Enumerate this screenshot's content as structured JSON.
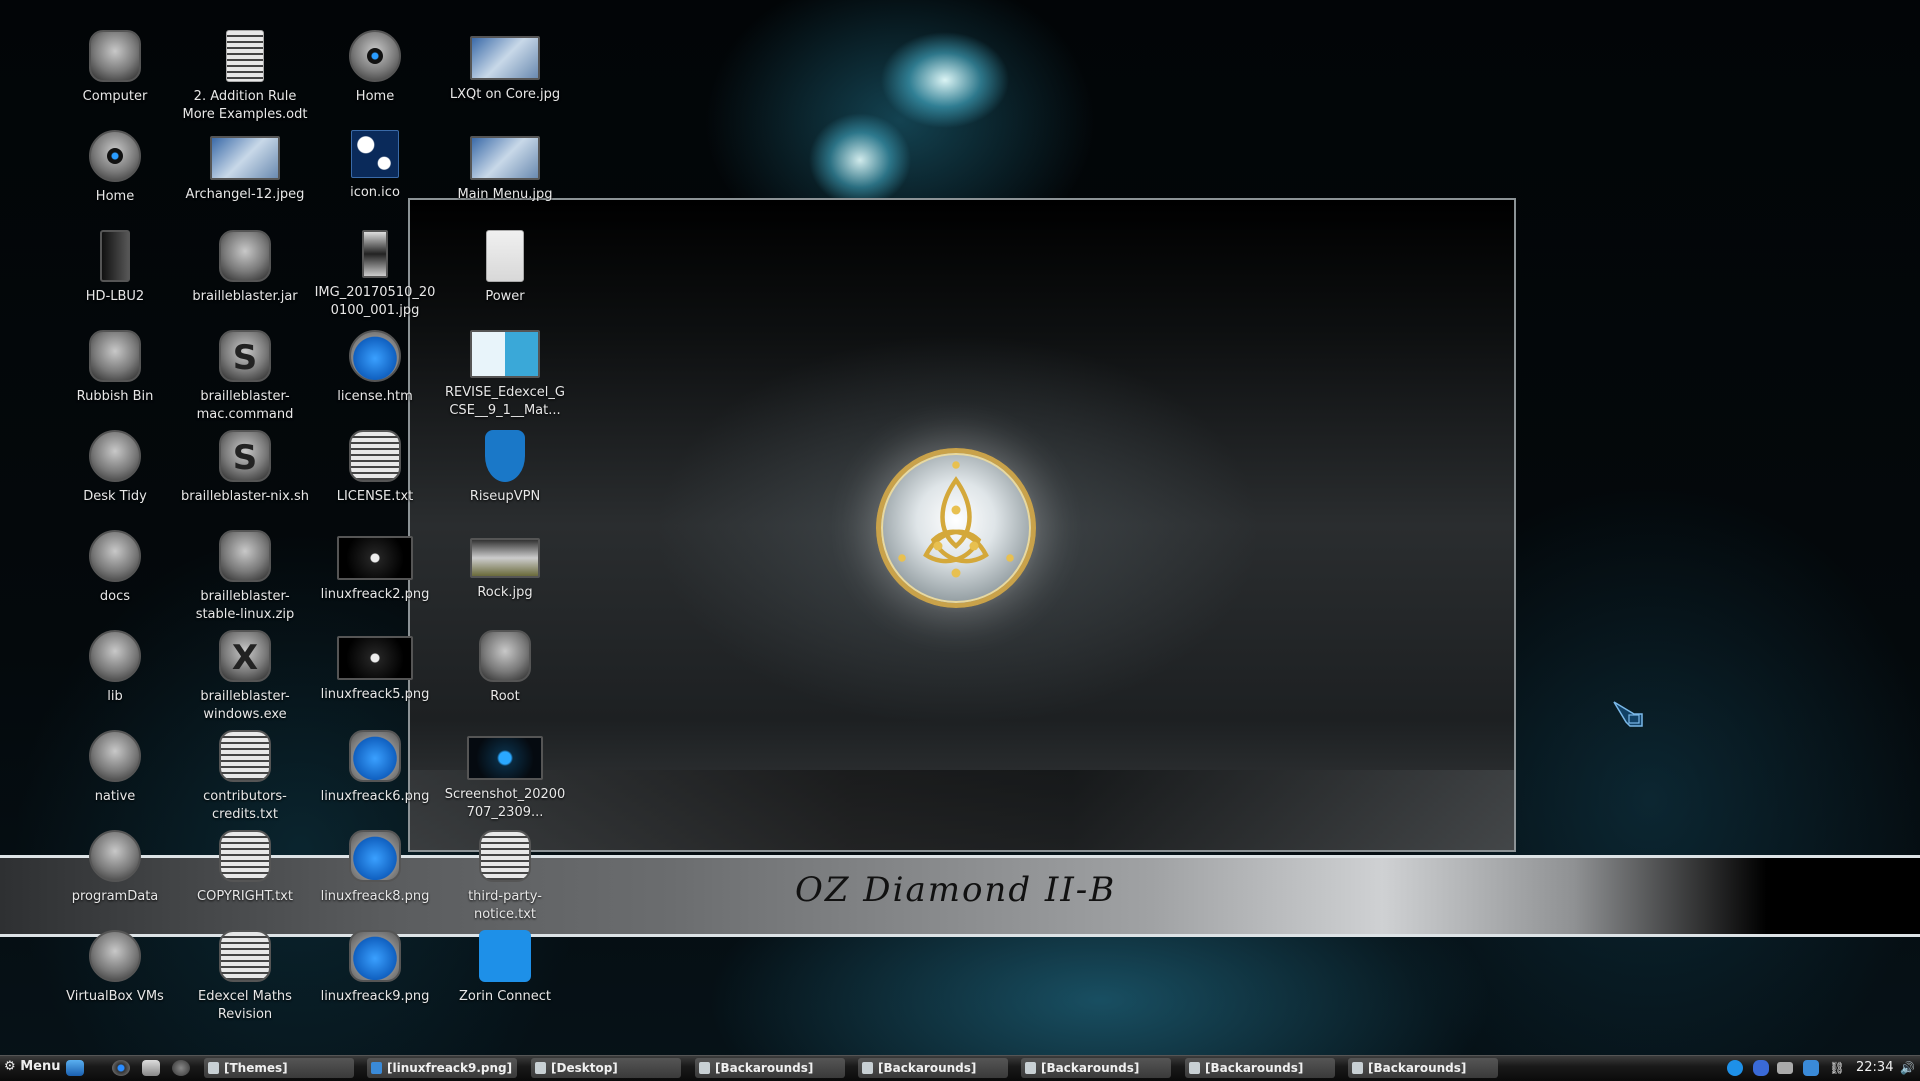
{
  "desktop": {
    "wallpaper_title": "OZ Diamond II-B",
    "icons": [
      {
        "label": "Computer",
        "type": "computer-icon"
      },
      {
        "label": "2. Addition Rule More Examples.odt",
        "type": "document-icon"
      },
      {
        "label": "Home",
        "type": "home-icon"
      },
      {
        "label": "LXQt on Core.jpg",
        "type": "image-thumbnail-icon"
      },
      {
        "label": "Home",
        "type": "home-icon"
      },
      {
        "label": "Archangel-12.jpeg",
        "type": "image-thumbnail-icon"
      },
      {
        "label": "icon.ico",
        "type": "image-thumbnail-icon"
      },
      {
        "label": "Main Menu.jpg",
        "type": "image-thumbnail-icon"
      },
      {
        "label": "HD-LBU2",
        "type": "drive-icon"
      },
      {
        "label": "brailleblaster.jar",
        "type": "archive-icon"
      },
      {
        "label": "IMG_20170510_200100_001.jpg",
        "type": "image-thumbnail-icon"
      },
      {
        "label": "Power",
        "type": "blank-file-icon"
      },
      {
        "label": "Rubbish Bin",
        "type": "trash-icon"
      },
      {
        "label": "brailleblaster-mac.command",
        "type": "script-icon"
      },
      {
        "label": "license.htm",
        "type": "html-icon"
      },
      {
        "label": "REVISE_Edexcel_GCSE__9_1__Mat...",
        "type": "pdf-thumbnail-icon"
      },
      {
        "label": "Desk Tidy",
        "type": "folder-icon"
      },
      {
        "label": "brailleblaster-nix.sh",
        "type": "script-icon"
      },
      {
        "label": "LICENSE.txt",
        "type": "text-file-icon"
      },
      {
        "label": "RiseupVPN",
        "type": "vpn-icon"
      },
      {
        "label": "docs",
        "type": "folder-icon"
      },
      {
        "label": "brailleblaster-stable-linux.zip",
        "type": "archive-icon"
      },
      {
        "label": "linuxfreack2.png",
        "type": "image-thumbnail-icon"
      },
      {
        "label": "Rock.jpg",
        "type": "image-thumbnail-icon"
      },
      {
        "label": "lib",
        "type": "folder-icon"
      },
      {
        "label": "brailleblaster-windows.exe",
        "type": "executable-icon"
      },
      {
        "label": "linuxfreack5.png",
        "type": "image-thumbnail-icon"
      },
      {
        "label": "Root",
        "type": "root-icon"
      },
      {
        "label": "native",
        "type": "folder-icon"
      },
      {
        "label": "contributors-credits.txt",
        "type": "text-file-icon"
      },
      {
        "label": "linuxfreack6.png",
        "type": "image-file-icon"
      },
      {
        "label": "Screenshot_20200707_2309...",
        "type": "image-thumbnail-icon"
      },
      {
        "label": "programData",
        "type": "folder-icon"
      },
      {
        "label": "COPYRIGHT.txt",
        "type": "text-file-icon"
      },
      {
        "label": "linuxfreack8.png",
        "type": "image-file-icon"
      },
      {
        "label": "third-party-notice.txt",
        "type": "text-file-icon"
      },
      {
        "label": "VirtualBox VMs",
        "type": "folder-icon"
      },
      {
        "label": "Edexcel Maths Revision",
        "type": "text-file-icon"
      },
      {
        "label": "linuxfreack9.png",
        "type": "image-file-icon"
      },
      {
        "label": "Zorin Connect",
        "type": "zorin-connect-icon"
      }
    ]
  },
  "taskbar": {
    "menu_label": "Menu",
    "quick_launch": [
      "file-manager-icon",
      "webcam-icon",
      "terminal-icon",
      "folder-icon"
    ],
    "tasks": [
      {
        "label": "[Themes]",
        "icon": "folder-icon"
      },
      {
        "label": "[linuxfreack9.png]",
        "icon": "image-viewer-icon"
      },
      {
        "label": "[Desktop]",
        "icon": "folder-icon"
      },
      {
        "label": "[Backarounds]",
        "icon": "folder-icon"
      },
      {
        "label": "[Backarounds]",
        "icon": "folder-icon"
      },
      {
        "label": "[Backarounds]",
        "icon": "folder-icon"
      },
      {
        "label": "[Backarounds]",
        "icon": "folder-icon"
      },
      {
        "label": "[Backarounds]",
        "icon": "folder-icon"
      }
    ],
    "tray": [
      "update-icon",
      "bluetooth-icon",
      "storage-icon",
      "vpn-tray-icon",
      "network-icon"
    ],
    "clock": "22:34",
    "volume_icon": "volume-icon"
  },
  "colors": {
    "accent_blue": "#1e90e8",
    "banner_gold": "#c9a24a"
  }
}
